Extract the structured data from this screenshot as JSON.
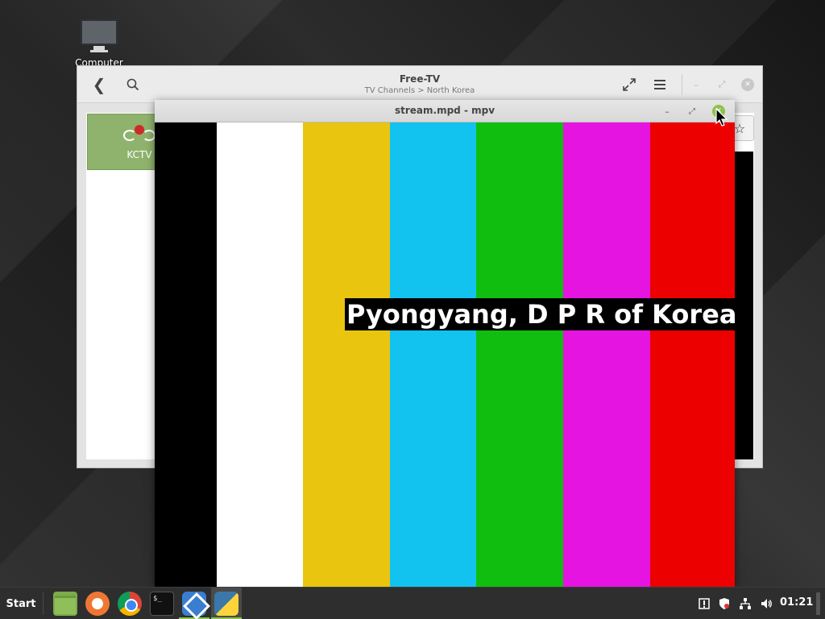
{
  "desktop": {
    "icons": [
      {
        "label": "Computer",
        "icon": "monitor-icon"
      }
    ]
  },
  "freetv_window": {
    "title": "Free-TV",
    "subtitle": "TV Channels > North Korea",
    "channels": [
      {
        "label": "KCTV",
        "logo": "kctv-logo-icon"
      }
    ]
  },
  "mpv_window": {
    "title": "stream.mpd - mpv",
    "caption": "Pyongyang, D P R of Korea",
    "colors": [
      "#000000",
      "#ffffff",
      "#e9c50f",
      "#12c3ef",
      "#10be10",
      "#e514e1",
      "#ec0000"
    ]
  },
  "taskbar": {
    "start_label": "Start",
    "launchers": [
      "files-icon",
      "firefox-icon",
      "chrome-icon",
      "terminal-icon",
      "free-tv-icon",
      "python-icon"
    ],
    "tray": [
      "update-manager-icon",
      "shield-icon",
      "network-icon",
      "volume-icon"
    ],
    "clock": "01:21",
    "terminal_glyph": "$_"
  }
}
